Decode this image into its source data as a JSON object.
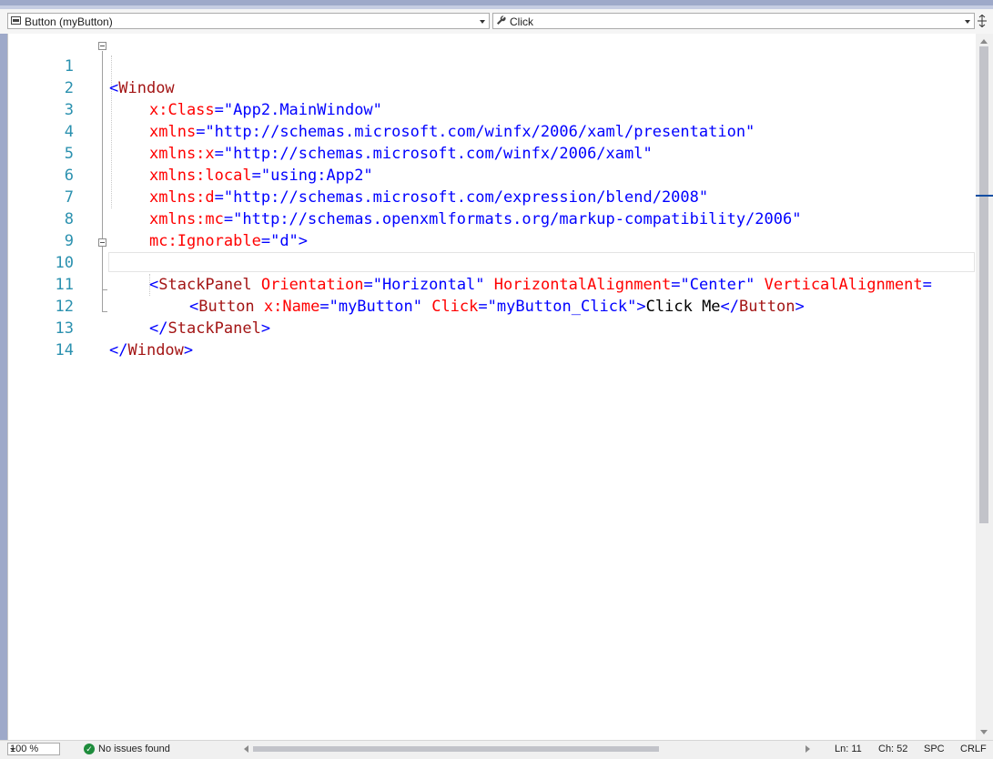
{
  "navbar": {
    "type_combo": {
      "value": "Button (myButton)",
      "icon": "element-icon"
    },
    "member_combo": {
      "value": "Click",
      "icon": "wrench-icon"
    },
    "split_icon": "split-window-icon"
  },
  "editor": {
    "lines": [
      {
        "num": "1"
      },
      {
        "num": "2"
      },
      {
        "num": "3"
      },
      {
        "num": "4"
      },
      {
        "num": "5"
      },
      {
        "num": "6"
      },
      {
        "num": "7"
      },
      {
        "num": "8"
      },
      {
        "num": "9"
      },
      {
        "num": "10"
      },
      {
        "num": "11"
      },
      {
        "num": "12"
      },
      {
        "num": "13"
      },
      {
        "num": "14"
      }
    ],
    "code": {
      "l1": {
        "open": "<",
        "tag": "Window"
      },
      "l2": {
        "attr": "x:Class",
        "eq": "=",
        "val": "\"App2.MainWindow\""
      },
      "l3": {
        "attr": "xmlns",
        "eq": "=",
        "val": "\"http://schemas.microsoft.com/winfx/2006/xaml/presentation\""
      },
      "l4": {
        "attr": "xmlns:x",
        "eq": "=",
        "val": "\"http://schemas.microsoft.com/winfx/2006/xaml\""
      },
      "l5": {
        "attr": "xmlns:local",
        "eq": "=",
        "val": "\"using:App2\""
      },
      "l6": {
        "attr": "xmlns:d",
        "eq": "=",
        "val": "\"http://schemas.microsoft.com/expression/blend/2008\""
      },
      "l7": {
        "attr": "xmlns:mc",
        "eq": "=",
        "val": "\"http://schemas.openxmlformats.org/markup-compatibility/2006\""
      },
      "l8": {
        "attr": "mc:Ignorable",
        "eq": "=",
        "val": "\"d\"",
        "close": ">"
      },
      "l10": {
        "open": "<",
        "tag": "StackPanel",
        "a1": "Orientation",
        "v1": "\"Horizontal\"",
        "a2": "HorizontalAlignment",
        "v2": "\"Center\"",
        "a3": "VerticalAlignment",
        "eq": "="
      },
      "l11": {
        "open": "<",
        "tag": "Button",
        "a1": "x:Name",
        "v1": "\"myButton\"",
        "a2": "Click",
        "v2": "\"myButton_Click\"",
        "gt": ">",
        "content": "Click Me",
        "closeopen": "</",
        "closetag": "Button",
        "closegt": ">"
      },
      "l12": {
        "open": "</",
        "tag": "StackPanel",
        "gt": ">"
      },
      "l13": {
        "open": "</",
        "tag": "Window",
        "gt": ">"
      }
    }
  },
  "statusbar": {
    "zoom": "100 %",
    "issues": "No issues found",
    "ln": "Ln: 11",
    "ch": "Ch: 52",
    "spc": "SPC",
    "crlf": "CRLF"
  }
}
